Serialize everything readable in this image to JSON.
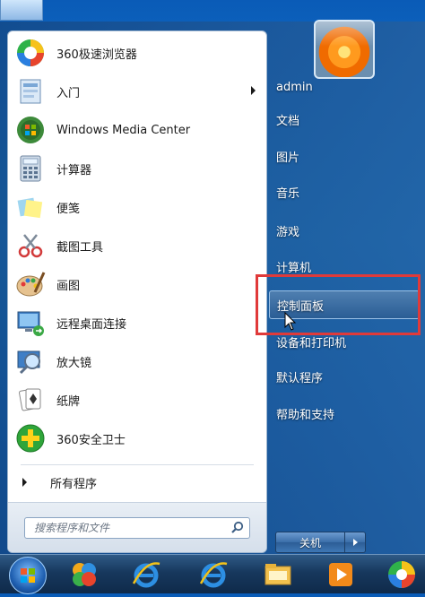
{
  "programs": [
    {
      "label": "360极速浏览器",
      "icon": "360-browser-icon"
    },
    {
      "label": "入门",
      "icon": "getting-started-icon",
      "has_submenu": true
    },
    {
      "label": "Windows Media Center",
      "icon": "windows-media-center-icon"
    },
    {
      "label": "计算器",
      "icon": "calculator-icon"
    },
    {
      "label": "便笺",
      "icon": "sticky-notes-icon"
    },
    {
      "label": "截图工具",
      "icon": "snipping-tool-icon"
    },
    {
      "label": "画图",
      "icon": "paint-icon"
    },
    {
      "label": "远程桌面连接",
      "icon": "remote-desktop-icon"
    },
    {
      "label": "放大镜",
      "icon": "magnifier-icon"
    },
    {
      "label": "纸牌",
      "icon": "solitaire-icon"
    },
    {
      "label": "360安全卫士",
      "icon": "360-safe-icon"
    }
  ],
  "all_programs_label": "所有程序",
  "search": {
    "placeholder": "搜索程序和文件"
  },
  "right_items": [
    {
      "label": "admin"
    },
    {
      "label": "文档"
    },
    {
      "label": "图片"
    },
    {
      "label": "音乐"
    },
    {
      "label": "游戏"
    },
    {
      "label": "计算机"
    },
    {
      "label": "控制面板",
      "highlighted": true
    },
    {
      "label": "设备和打印机"
    },
    {
      "label": "默认程序"
    },
    {
      "label": "帮助和支持"
    }
  ],
  "shutdown": {
    "label": "关机"
  },
  "taskbar_icons": [
    "start-orb-icon",
    "360-taskbar-icon",
    "ie-browser-icon",
    "ie-browser-icon",
    "file-explorer-icon",
    "media-player-icon",
    "360-browser-icon"
  ],
  "colors": {
    "highlight_box": "#e03a3a",
    "accent": "#2a5d95"
  }
}
